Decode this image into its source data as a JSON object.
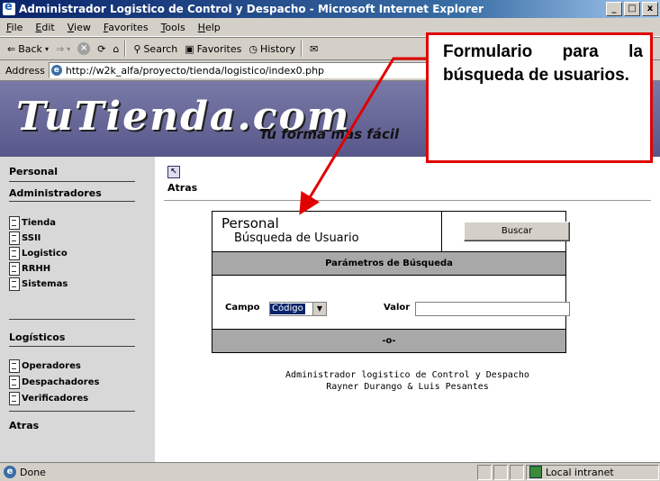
{
  "window": {
    "title": "Administrador Logistico de Control y Despacho - Microsoft Internet Explorer",
    "buttons": [
      "_",
      "□",
      "x"
    ]
  },
  "menu": [
    "File",
    "Edit",
    "View",
    "Favorites",
    "Tools",
    "Help"
  ],
  "toolbar": {
    "back": "Back",
    "search": "Search",
    "favorites": "Favorites",
    "history": "History"
  },
  "address": {
    "label": "Address",
    "url": "http://w2k_alfa/proyecto/tienda/logistico/index0.php"
  },
  "banner": {
    "logo": "TuTienda.com",
    "tagline": "Tu forma más fácil"
  },
  "sidebar": {
    "personal": "Personal",
    "administradores": "Administradores",
    "items": [
      "Tienda",
      "SSII",
      "Logistico",
      "RRHH",
      "Sistemas"
    ],
    "logisticos": "Logísticos",
    "logisticos_items": [
      "Operadores",
      "Despachadores",
      "Verificadores"
    ],
    "atras": "Atras"
  },
  "content": {
    "back_label": "Atras",
    "form": {
      "title": "Personal",
      "subtitle": "Búsqueda de Usuario",
      "search_button": "Buscar",
      "params_header": "Parámetros de Búsqueda",
      "campo_label": "Campo",
      "campo_value": "Código",
      "valor_label": "Valor",
      "valor_value": "",
      "footer_bar": "-o-"
    },
    "footer_line1": "Administrador logistico de Control y Despacho",
    "footer_line2": "Rayner Durango & Luis Pesantes"
  },
  "status": {
    "text": "Done",
    "zone": "Local intranet"
  },
  "callout": {
    "text": "Formulario para la búsqueda de usuarios."
  },
  "colors": {
    "callout_border": "#e00000",
    "titlebar": "#0a246a",
    "banner": "#6a6a9a"
  }
}
